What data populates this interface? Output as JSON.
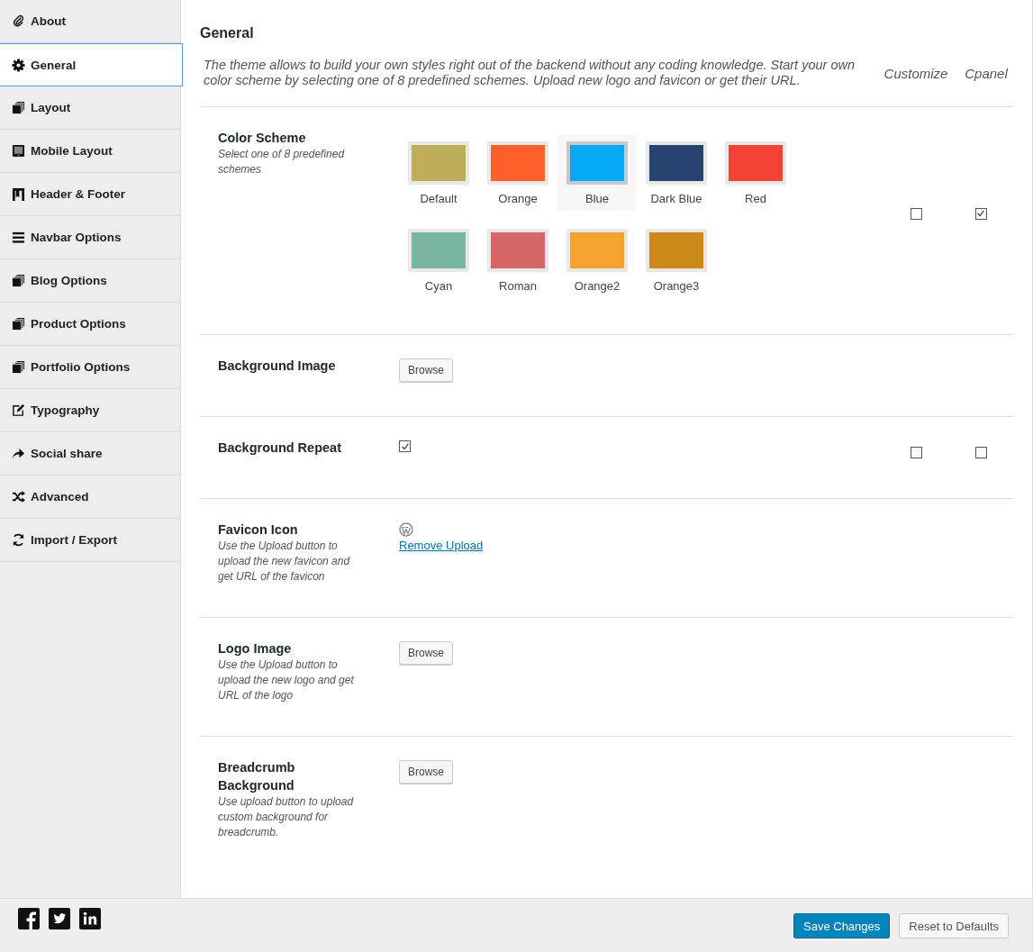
{
  "sidebar": {
    "items": [
      {
        "label": "About",
        "kind": "paperclip",
        "selected": false
      },
      {
        "label": "General",
        "kind": "gear",
        "selected": true
      },
      {
        "label": "Layout",
        "kind": "pages",
        "selected": false
      },
      {
        "label": "Mobile Layout",
        "kind": "tablet",
        "selected": false
      },
      {
        "label": "Header & Footer",
        "kind": "bookmark",
        "selected": false
      },
      {
        "label": "Navbar Options",
        "kind": "bars",
        "selected": false
      },
      {
        "label": "Blog Options",
        "kind": "pages",
        "selected": false
      },
      {
        "label": "Product Options",
        "kind": "pages",
        "selected": false
      },
      {
        "label": "Portfolio Options",
        "kind": "pages",
        "selected": false
      },
      {
        "label": "Typography",
        "kind": "edit",
        "selected": false
      },
      {
        "label": "Social share",
        "kind": "share",
        "selected": false
      },
      {
        "label": "Advanced",
        "kind": "shuffle",
        "selected": false
      },
      {
        "label": "Import / Export",
        "kind": "refresh",
        "selected": false
      }
    ]
  },
  "content": {
    "title": "General",
    "intro": "The theme allows to build your own styles right out of the backend without any coding knowledge. Start your own color scheme by selecting one of 8 predefined schemes. Upload new logo and favicon or get their URL.",
    "columns": [
      "Customize",
      "Cpanel"
    ],
    "settings": [
      {
        "kind": "swatches",
        "label": "Color Scheme",
        "description": "Select one of 8 predefined schemes",
        "swatches": [
          {
            "label": "Default",
            "color": "#bead5b",
            "selected": false
          },
          {
            "label": "Orange",
            "color": "#ff5f2b",
            "selected": false
          },
          {
            "label": "Blue",
            "color": "#05a9f4",
            "selected": true
          },
          {
            "label": "Dark Blue",
            "color": "#26446f",
            "selected": false
          },
          {
            "label": "Red",
            "color": "#f44336",
            "selected": false
          },
          {
            "label": "Cyan",
            "color": "#79b5a0",
            "selected": false
          },
          {
            "label": "Roman",
            "color": "#d66766",
            "selected": false
          },
          {
            "label": "Orange2",
            "color": "#f4a331",
            "selected": false
          },
          {
            "label": "Orange3",
            "color": "#cd881b",
            "selected": false
          }
        ],
        "customize": false,
        "cpanel": true
      },
      {
        "kind": "browse",
        "label": "Background Image",
        "button": "Browse"
      },
      {
        "kind": "checkbox",
        "label": "Background Repeat",
        "checked": true,
        "customize": false,
        "cpanel": false
      },
      {
        "kind": "upload",
        "label": "Favicon Icon",
        "description": "Use the Upload button to upload the new favicon and get URL of the favicon",
        "link": "Remove Upload"
      },
      {
        "kind": "browse",
        "label": "Logo Image",
        "description": "Use the Upload button to upload the new logo and get URL of the logo",
        "button": "Browse"
      },
      {
        "kind": "browse",
        "label": "Breadcrumb Background",
        "description": "Use upload button to upload custom background for breadcrumb.",
        "button": "Browse"
      }
    ]
  },
  "footer": {
    "buttons": [
      {
        "label": "Save Changes",
        "kind": "primary"
      },
      {
        "label": "Reset to Defaults",
        "kind": "secondary"
      }
    ]
  }
}
